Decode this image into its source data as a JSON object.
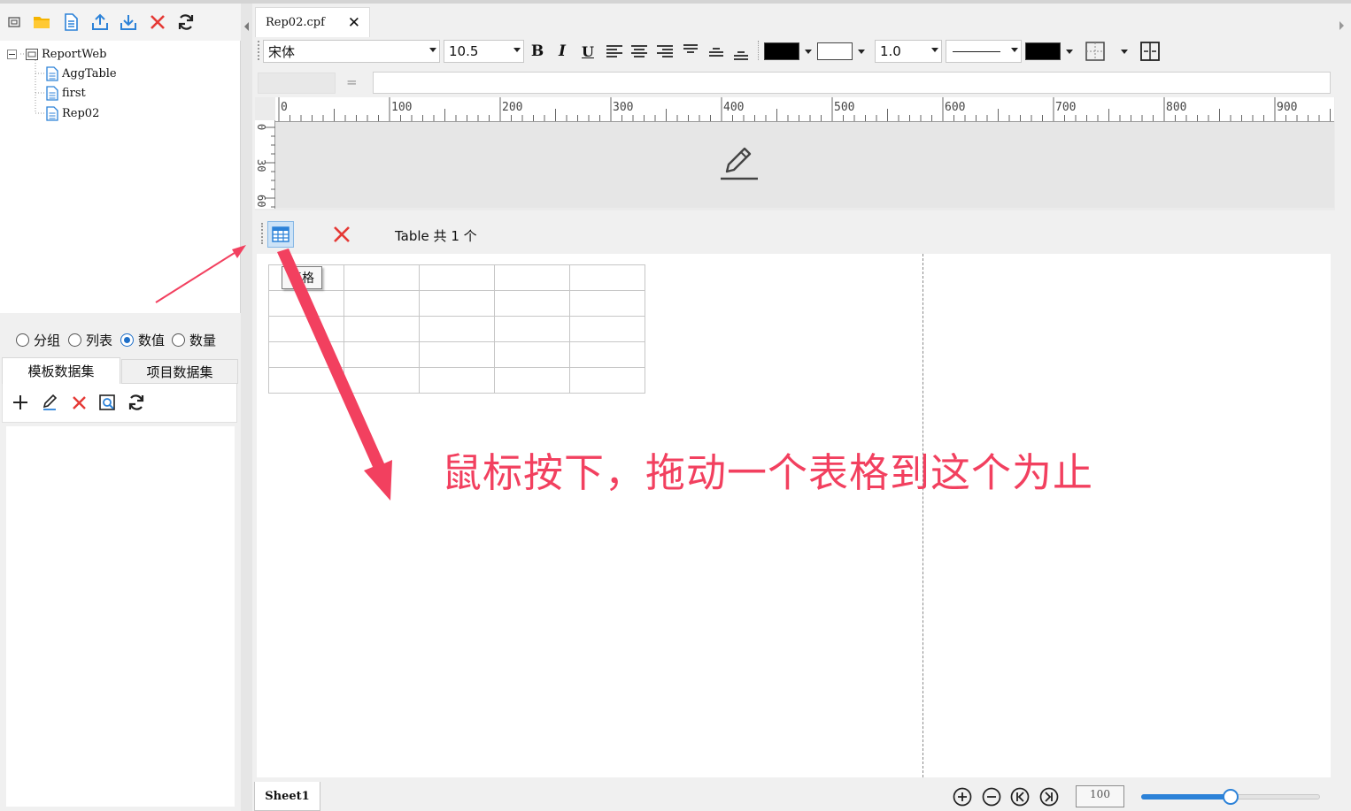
{
  "tree": {
    "root": "ReportWeb",
    "children": [
      "AggTable",
      "first",
      "Rep02"
    ]
  },
  "options": {
    "radios": [
      {
        "label": "分组",
        "checked": false
      },
      {
        "label": "列表",
        "checked": false
      },
      {
        "label": "数值",
        "checked": true
      },
      {
        "label": "数量",
        "checked": false
      }
    ],
    "tabs": [
      "模板数据集",
      "项目数据集"
    ]
  },
  "document": {
    "tab_title": "Rep02.cpf",
    "close_glyph": "✕"
  },
  "format": {
    "font_family": "宋体",
    "font_size": "10.5",
    "bold": "B",
    "italic": "I",
    "underline": "U",
    "line_width": "1.0",
    "font_color": "#000000",
    "fill_color": "#ffffff",
    "border_color": "#000000"
  },
  "formula": {
    "equals": "="
  },
  "ruler": {
    "h_labels": [
      "0",
      "100",
      "200",
      "300",
      "400",
      "500",
      "600",
      "700",
      "800",
      "900"
    ],
    "v_labels": [
      "0",
      "30",
      "60"
    ]
  },
  "controls": {
    "count_text": "Table 共 1 个",
    "tooltip": "表格"
  },
  "annotation": {
    "text": "鼠标按下，拖动一个表格到这个为止",
    "color": "#f2405f"
  },
  "bottom": {
    "sheet": "Sheet1",
    "zoom": "100",
    "zoom_slider_fraction": 0.5
  },
  "colors": {
    "accent": "#2c82d8",
    "delete": "#e53935",
    "arrow": "#f2405f"
  }
}
